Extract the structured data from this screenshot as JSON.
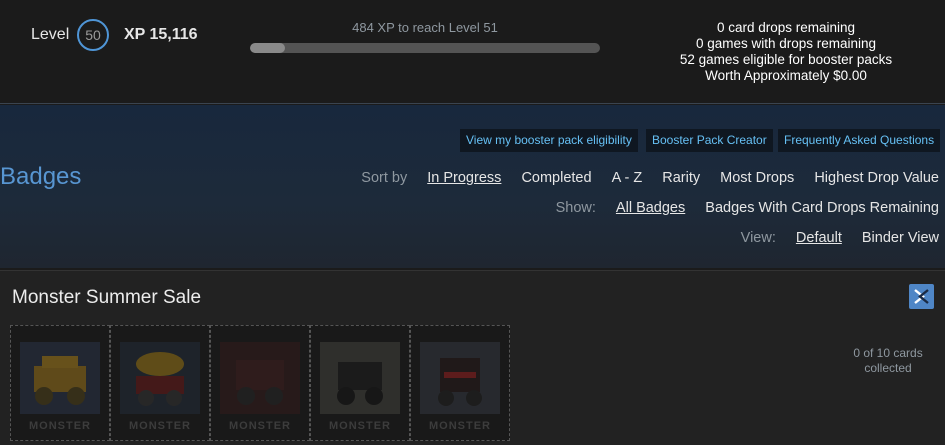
{
  "level": {
    "label": "Level",
    "value": "50"
  },
  "xp": {
    "label": "XP 15,116",
    "next_text": "484 XP to reach Level 51",
    "progress": 0.1
  },
  "drops": {
    "card_drops": "0 card drops remaining",
    "games_drops": "0 games with drops remaining",
    "booster_eligible": "52 games eligible for booster packs",
    "worth": "Worth Approximately $0.00"
  },
  "links": {
    "eligibility": "View my booster pack eligibility",
    "creator": "Booster Pack Creator",
    "faq": "Frequently Asked Questions"
  },
  "page_title": "Badges",
  "sort": {
    "label": "Sort by",
    "options": [
      "In Progress",
      "Completed",
      "A - Z",
      "Rarity",
      "Most Drops",
      "Highest Drop Value"
    ]
  },
  "show": {
    "label": "Show:",
    "options": [
      "All Badges",
      "Badges With Card Drops Remaining"
    ]
  },
  "view": {
    "label": "View:",
    "options": [
      "Default",
      "Binder View"
    ]
  },
  "badge_panel": {
    "title": "Monster Summer Sale",
    "card_logo": "MONSTER",
    "cards_line1": "0 of 10 cards",
    "cards_line2": "collected"
  },
  "colors": {
    "accent": "#66c0f4",
    "title_blue": "#5896d2",
    "level_ring": "#4f95d6"
  }
}
